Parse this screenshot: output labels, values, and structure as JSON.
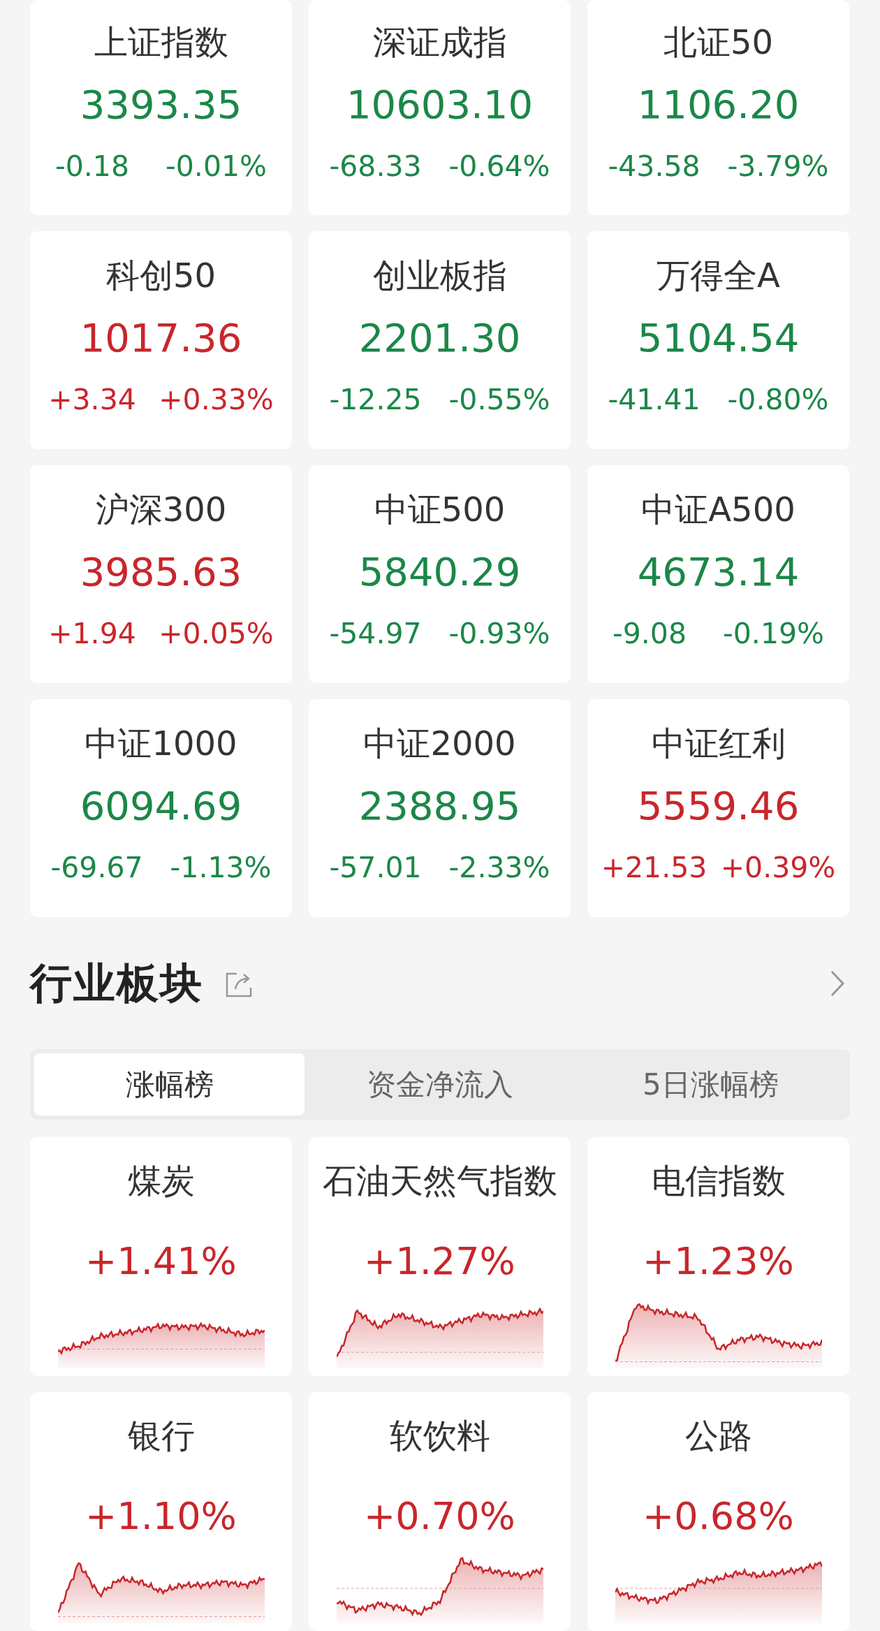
{
  "indices": [
    {
      "name": "上证指数",
      "value": "3393.35",
      "change": "-0.18",
      "percent": "-0.01%",
      "color": "#1b8748"
    },
    {
      "name": "深证成指",
      "value": "10603.10",
      "change": "-68.33",
      "percent": "-0.64%",
      "color": "#1b8748"
    },
    {
      "name": "北证50",
      "value": "1106.20",
      "change": "-43.58",
      "percent": "-3.79%",
      "color": "#1b8748"
    },
    {
      "name": "科创50",
      "value": "1017.36",
      "change": "+3.34",
      "percent": "+0.33%",
      "color": "#c8262b"
    },
    {
      "name": "创业板指",
      "value": "2201.30",
      "change": "-12.25",
      "percent": "-0.55%",
      "color": "#1b8748"
    },
    {
      "name": "万得全A",
      "value": "5104.54",
      "change": "-41.41",
      "percent": "-0.80%",
      "color": "#1b8748"
    },
    {
      "name": "沪深300",
      "value": "3985.63",
      "change": "+1.94",
      "percent": "+0.05%",
      "color": "#c8262b"
    },
    {
      "name": "中证500",
      "value": "5840.29",
      "change": "-54.97",
      "percent": "-0.93%",
      "color": "#1b8748"
    },
    {
      "name": "中证A500",
      "value": "4673.14",
      "change": "-9.08",
      "percent": "-0.19%",
      "color": "#1b8748"
    },
    {
      "name": "中证1000",
      "value": "6094.69",
      "change": "-69.67",
      "percent": "-1.13%",
      "color": "#1b8748"
    },
    {
      "name": "中证2000",
      "value": "2388.95",
      "change": "-57.01",
      "percent": "-2.33%",
      "color": "#1b8748"
    },
    {
      "name": "中证红利",
      "value": "5559.46",
      "change": "+21.53",
      "percent": "+0.39%",
      "color": "#c8262b"
    }
  ],
  "sector_section": {
    "title": "行业板块",
    "tabs": [
      {
        "label": "涨幅榜",
        "selected": true
      },
      {
        "label": "资金净流入",
        "selected": false
      },
      {
        "label": "5日涨幅榜",
        "selected": false
      }
    ],
    "sectors": [
      {
        "name": "煤炭",
        "percent": "+1.41%"
      },
      {
        "name": "石油天然气指数",
        "percent": "+1.27%"
      },
      {
        "name": "电信指数",
        "percent": "+1.23%"
      },
      {
        "name": "银行",
        "percent": "+1.10%"
      },
      {
        "name": "软饮料",
        "percent": "+0.70%"
      },
      {
        "name": "公路",
        "percent": "+0.68%"
      }
    ]
  }
}
